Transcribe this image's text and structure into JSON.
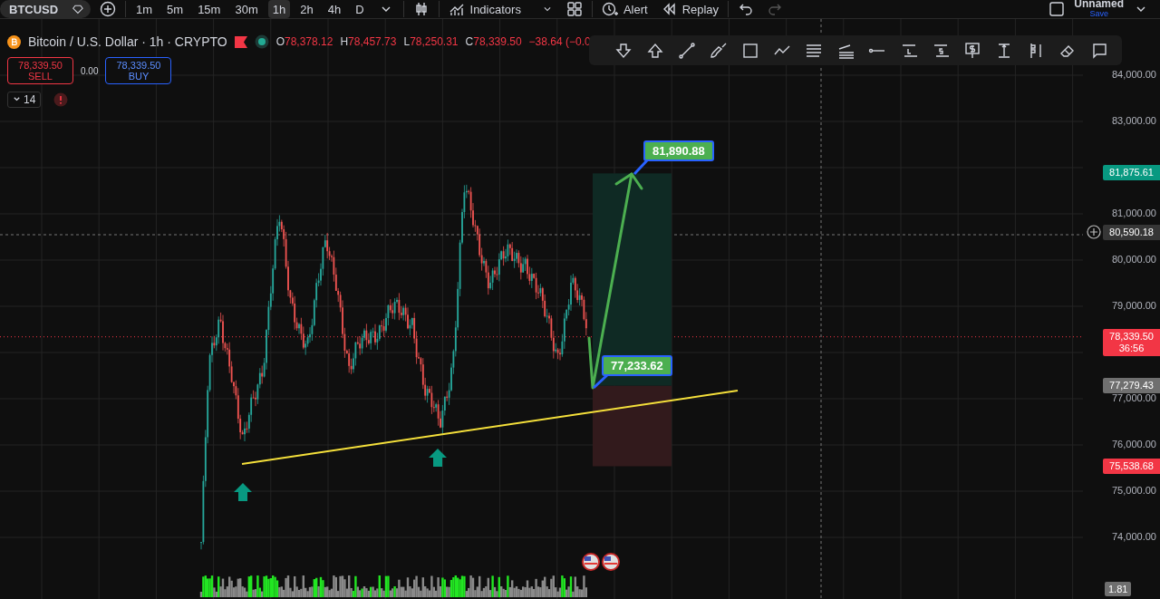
{
  "symbol": "BTCUSD",
  "intervals": [
    {
      "label": "1m",
      "selected": false
    },
    {
      "label": "5m",
      "selected": false
    },
    {
      "label": "15m",
      "selected": false
    },
    {
      "label": "30m",
      "selected": false
    },
    {
      "label": "1h",
      "selected": true
    },
    {
      "label": "2h",
      "selected": false
    },
    {
      "label": "4h",
      "selected": false
    },
    {
      "label": "D",
      "selected": false
    }
  ],
  "toolbar": {
    "indicators": "Indicators",
    "alert": "Alert",
    "replay": "Replay"
  },
  "layout": {
    "name": "Unnamed",
    "save": "Save"
  },
  "legend": {
    "title": "Bitcoin / U.S. Dollar · 1h · CRYPTO",
    "ohlc": [
      {
        "key": "O",
        "value": "78,378.12"
      },
      {
        "key": "H",
        "value": "78,457.73"
      },
      {
        "key": "L",
        "value": "78,250.31"
      },
      {
        "key": "C",
        "value": "78,339.50"
      }
    ],
    "change": "−38.64 (−0.0"
  },
  "trade": {
    "sell_price": "78,339.50",
    "sell": "SELL",
    "spread": "0.00",
    "buy_price": "78,339.50",
    "buy": "BUY"
  },
  "indicators_count": "14",
  "price_axis": {
    "ticks": [
      "84,000.00",
      "83,000.00",
      "81,000.00",
      "80,000.00",
      "79,000.00",
      "77,000.00",
      "76,000.00",
      "75,000.00",
      "74,000.00"
    ]
  },
  "price_labels": [
    {
      "text": "81,875.61",
      "color": "#089981"
    },
    {
      "text": "80,590.18",
      "color": "#363636"
    },
    {
      "text": "78,339.50",
      "sub": "36:56",
      "color": "#f23645"
    },
    {
      "text": "77,279.43",
      "color": "#6f6f6f"
    },
    {
      "text": "75,538.68",
      "color": "#f23645"
    }
  ],
  "volume_label": "1.81",
  "annotations": [
    {
      "text": "81,890.88"
    },
    {
      "text": "77,233.62"
    }
  ]
}
